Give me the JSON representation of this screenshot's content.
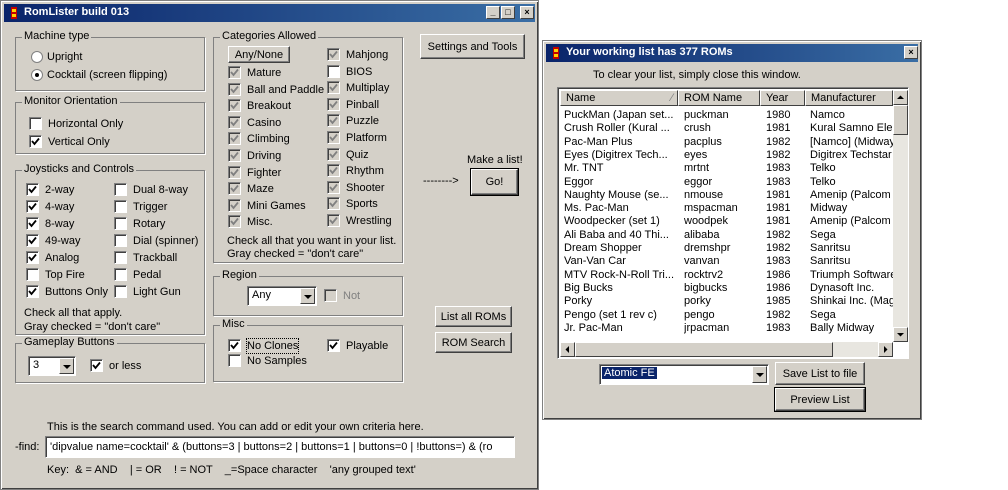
{
  "main_window": {
    "title": "RomLister build 013",
    "machine_type": {
      "label": "Machine type",
      "options": [
        {
          "label": "Upright",
          "selected": false
        },
        {
          "label": "Cocktail (screen flipping)",
          "selected": true
        }
      ]
    },
    "monitor": {
      "label": "Monitor Orientation",
      "options": [
        {
          "label": "Horizontal Only",
          "state": "unchecked"
        },
        {
          "label": "Vertical Only",
          "state": "checked"
        }
      ]
    },
    "joysticks": {
      "label": "Joysticks and Controls",
      "left": [
        {
          "label": "2-way",
          "state": "checked"
        },
        {
          "label": "4-way",
          "state": "checked"
        },
        {
          "label": "8-way",
          "state": "checked"
        },
        {
          "label": "49-way",
          "state": "checked"
        },
        {
          "label": "Analog",
          "state": "checked"
        },
        {
          "label": "Top Fire",
          "state": "unchecked"
        },
        {
          "label": "Buttons Only",
          "state": "checked"
        }
      ],
      "right": [
        {
          "label": "Dual 8-way",
          "state": "unchecked"
        },
        {
          "label": "Trigger",
          "state": "unchecked"
        },
        {
          "label": "Rotary",
          "state": "unchecked"
        },
        {
          "label": "Dial (spinner)",
          "state": "unchecked"
        },
        {
          "label": "Trackball",
          "state": "unchecked"
        },
        {
          "label": "Pedal",
          "state": "unchecked"
        },
        {
          "label": "Light Gun",
          "state": "unchecked"
        }
      ],
      "note1": "Check all that apply.",
      "note2": "Gray checked = \"don't care\""
    },
    "gameplay": {
      "label": "Gameplay Buttons",
      "value": "3",
      "or_less_label": "or less",
      "or_less_state": "checked"
    },
    "categories": {
      "label": "Categories Allowed",
      "any_none": "Any/None",
      "left": [
        {
          "label": "Mature",
          "state": "gray"
        },
        {
          "label": "Ball and Paddle",
          "state": "gray"
        },
        {
          "label": "Breakout",
          "state": "gray"
        },
        {
          "label": "Casino",
          "state": "gray"
        },
        {
          "label": "Climbing",
          "state": "gray"
        },
        {
          "label": "Driving",
          "state": "gray"
        },
        {
          "label": "Fighter",
          "state": "gray"
        },
        {
          "label": "Maze",
          "state": "gray"
        },
        {
          "label": "Mini Games",
          "state": "gray"
        },
        {
          "label": "Misc.",
          "state": "gray"
        }
      ],
      "right": [
        {
          "label": "Mahjong",
          "state": "gray"
        },
        {
          "label": "BIOS",
          "state": "unchecked"
        },
        {
          "label": "Multiplay",
          "state": "gray"
        },
        {
          "label": "Pinball",
          "state": "gray"
        },
        {
          "label": "Puzzle",
          "state": "gray"
        },
        {
          "label": "Platform",
          "state": "gray"
        },
        {
          "label": "Quiz",
          "state": "gray"
        },
        {
          "label": "Rhythm",
          "state": "gray"
        },
        {
          "label": "Shooter",
          "state": "gray"
        },
        {
          "label": "Sports",
          "state": "gray"
        },
        {
          "label": "Wrestling",
          "state": "gray"
        }
      ],
      "note1": "Check all that you want in your list.",
      "note2": "Gray checked = \"don't care\""
    },
    "region": {
      "label": "Region",
      "value": "Any",
      "not_label": "Not"
    },
    "misc": {
      "label": "Misc",
      "no_clones": "No Clones",
      "no_samples": "No Samples",
      "playable": "Playable"
    },
    "buttons": {
      "settings": "Settings and Tools",
      "make_list_label": "Make a list!",
      "arrow": "-------->",
      "go": "Go!",
      "list_all": "List all ROMs",
      "rom_search": "ROM Search"
    },
    "search": {
      "caption": "This is the search command used.  You can add or edit your own criteria here.",
      "find_label": "-find:",
      "value": "'dipvalue name=cocktail' & (buttons=3 | buttons=2 | buttons=1 | buttons=0 | !buttons=) & (ro",
      "key": "Key:  & = AND    | = OR    ! = NOT    _=Space character    'any grouped text'"
    }
  },
  "list_window": {
    "title": "Your working list has 377 ROMs",
    "hint": "To clear your list, simply close this window.",
    "columns": [
      "Name",
      "ROM Name",
      "Year",
      "Manufacturer"
    ],
    "rows": [
      [
        "PuckMan (Japan set...",
        "puckman",
        "1980",
        "Namco"
      ],
      [
        "Crush Roller (Kural ...",
        "crush",
        "1981",
        "Kural Samno Elec"
      ],
      [
        "Pac-Man Plus",
        "pacplus",
        "1982",
        "[Namco] (Midway"
      ],
      [
        "Eyes (Digitrex Tech...",
        "eyes",
        "1982",
        "Digitrex Techstar"
      ],
      [
        "Mr. TNT",
        "mrtnt",
        "1983",
        "Telko"
      ],
      [
        "Eggor",
        "eggor",
        "1983",
        "Telko"
      ],
      [
        "Naughty Mouse (se...",
        "nmouse",
        "1981",
        "Amenip (Palcom Q"
      ],
      [
        "Ms. Pac-Man",
        "mspacman",
        "1981",
        "Midway"
      ],
      [
        "Woodpecker (set 1)",
        "woodpek",
        "1981",
        "Amenip (Palcom Q"
      ],
      [
        "Ali Baba and 40 Thi...",
        "alibaba",
        "1982",
        "Sega"
      ],
      [
        "Dream Shopper",
        "dremshpr",
        "1982",
        "Sanritsu"
      ],
      [
        "Van-Van Car",
        "vanvan",
        "1983",
        "Sanritsu"
      ],
      [
        "MTV Rock-N-Roll Tri...",
        "rocktrv2",
        "1986",
        "Triumph Software"
      ],
      [
        "Big Bucks",
        "bigbucks",
        "1986",
        "Dynasoft Inc."
      ],
      [
        "Porky",
        "porky",
        "1985",
        "Shinkai Inc. (Mag"
      ],
      [
        "Pengo (set 1 rev c)",
        "pengo",
        "1982",
        "Sega"
      ],
      [
        "Jr. Pac-Man",
        "jrpacman",
        "1983",
        "Bally Midway"
      ]
    ],
    "frontend": "Atomic FE",
    "save_label": "Save List to file",
    "preview_label": "Preview List"
  }
}
